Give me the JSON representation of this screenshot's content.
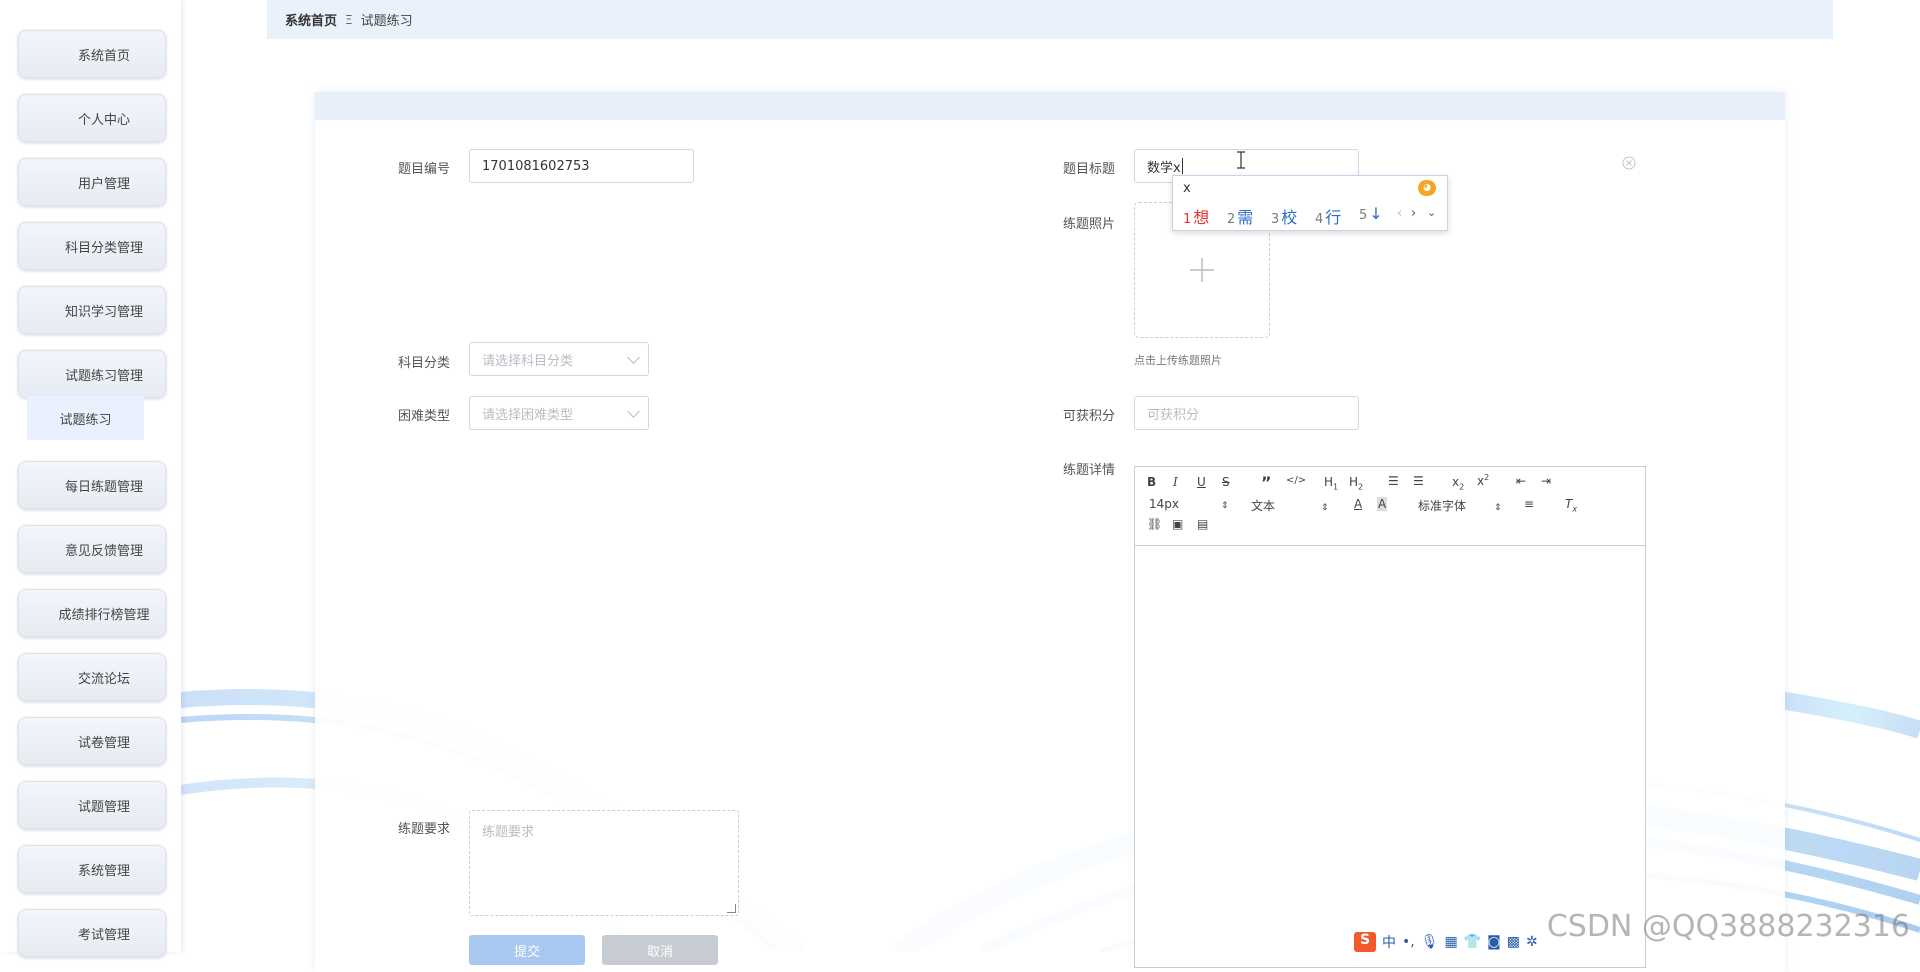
{
  "sidebar": {
    "items": [
      {
        "label": "系统首页"
      },
      {
        "label": "个人中心"
      },
      {
        "label": "用户管理"
      },
      {
        "label": "科目分类管理"
      },
      {
        "label": "知识学习管理"
      },
      {
        "label": "试题练习管理"
      },
      {
        "label": "每日练题管理"
      },
      {
        "label": "意见反馈管理"
      },
      {
        "label": "成绩排行榜管理"
      },
      {
        "label": "交流论坛"
      },
      {
        "label": "试卷管理"
      },
      {
        "label": "试题管理"
      },
      {
        "label": "系统管理"
      },
      {
        "label": "考试管理"
      }
    ],
    "active_sub": "试题练习"
  },
  "breadcrumb": {
    "home": "系统首页",
    "separator": "Ξ",
    "current": "试题练习"
  },
  "form": {
    "id_label": "题目编号",
    "id_value": "1701081602753",
    "title_label": "题目标题",
    "title_value": "数学x",
    "photo_label": "练题照片",
    "photo_hint": "点击上传练题照片",
    "subject_label": "科目分类",
    "subject_placeholder": "请选择科目分类",
    "difficulty_label": "困难类型",
    "difficulty_placeholder": "请选择困难类型",
    "points_label": "可获积分",
    "points_placeholder": "可获积分",
    "detail_label": "练题详情",
    "requirement_label": "练题要求",
    "requirement_placeholder": "练题要求",
    "submit_label": "提交",
    "cancel_label": "取消"
  },
  "editor": {
    "font_size": "14px",
    "text_format": "文本",
    "font_family": "标准字体"
  },
  "ime": {
    "composition": "x",
    "candidates": [
      {
        "num": "1",
        "text": "想"
      },
      {
        "num": "2",
        "text": "需"
      },
      {
        "num": "3",
        "text": "校"
      },
      {
        "num": "4",
        "text": "行"
      },
      {
        "num": "5",
        "text": "↓"
      }
    ]
  },
  "watermark": "CSDN @QQ3888232316",
  "tray": {
    "lang": "中",
    "punct": "•,"
  },
  "colors": {
    "accent": "#409eff",
    "breadcrumb_bg": "#e9f1fb",
    "ime_first": "#e8332a",
    "ime_other": "#2b6cc4"
  }
}
